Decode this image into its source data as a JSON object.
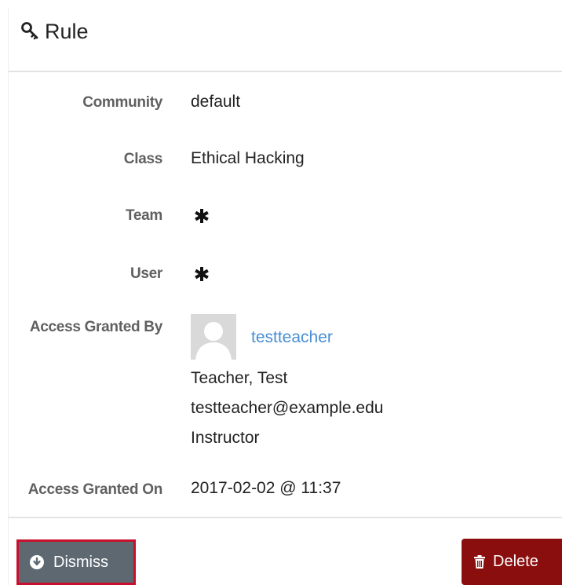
{
  "header": {
    "title": "Rule",
    "icon": "key-icon"
  },
  "fields": {
    "community": {
      "label": "Community",
      "value": "default"
    },
    "class": {
      "label": "Class",
      "value": "Ethical Hacking"
    },
    "team": {
      "label": "Team",
      "icon": "asterisk-icon"
    },
    "user": {
      "label": "User",
      "icon": "asterisk-icon"
    },
    "granted_by": {
      "label": "Access Granted By",
      "username": "testteacher",
      "full_name": "Teacher, Test",
      "email": "testteacher@example.edu",
      "role": "Instructor"
    },
    "granted_on": {
      "label": "Access Granted On",
      "value": "2017-02-02 @ 11:37"
    }
  },
  "actions": {
    "dismiss_label": "Dismiss",
    "dismiss_icon": "arrow-circle-down-icon",
    "delete_label": "Delete",
    "delete_icon": "trash-icon"
  },
  "colors": {
    "link": "#4a8fd6",
    "dismiss_bg": "#5d6871",
    "dismiss_border": "#c8102e",
    "delete_bg": "#8b0e0e",
    "label": "#606060"
  }
}
